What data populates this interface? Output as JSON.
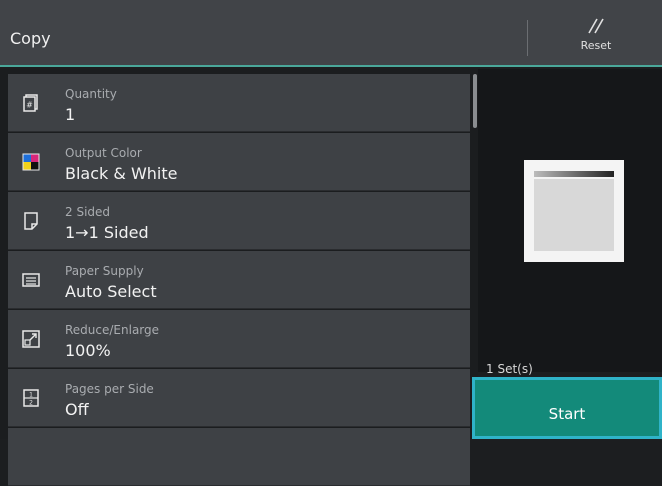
{
  "header": {
    "title": "Copy",
    "reset_label": "Reset"
  },
  "items": [
    {
      "label": "Quantity",
      "value": "1",
      "icon": "quantity-icon"
    },
    {
      "label": "Output Color",
      "value": "Black & White",
      "icon": "output-color-icon"
    },
    {
      "label": "2 Sided",
      "value": "1→1 Sided",
      "icon": "two-sided-icon"
    },
    {
      "label": "Paper Supply",
      "value": "Auto Select",
      "icon": "paper-supply-icon"
    },
    {
      "label": "Reduce/Enlarge",
      "value": "100%",
      "icon": "reduce-enlarge-icon"
    },
    {
      "label": "Pages per Side",
      "value": "Off",
      "icon": "pages-per-side-icon"
    }
  ],
  "preview": {
    "sets": "1 Set(s)"
  },
  "start_label": "Start",
  "colors": {
    "accent": "#4aa89a",
    "start": "#138a7a",
    "start_border": "#2fb3c8"
  }
}
